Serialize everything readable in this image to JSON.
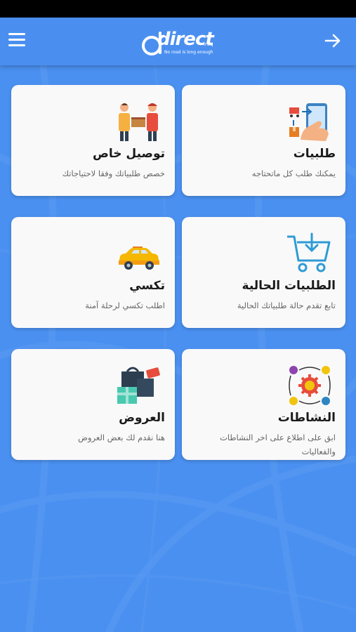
{
  "header": {
    "logo_text": "direct",
    "logo_sup": "iraq",
    "logo_tagline": "No road is long enough"
  },
  "cards": [
    {
      "title": "طلبيات",
      "subtitle": "يمكنك طلب كل ماتحتاجه",
      "icon": "phone-order-icon"
    },
    {
      "title": "توصيل خاص",
      "subtitle": "خصص طلبياتك وفقا لاحتياجاتك",
      "icon": "delivery-handover-icon"
    },
    {
      "title": "الطلبيات الحالية",
      "subtitle": "تابع تقدم حالة طلبياتك الحالية",
      "icon": "cart-icon"
    },
    {
      "title": "تكسي",
      "subtitle": "اطلب تكسي لرحلة آمنة",
      "icon": "taxi-icon"
    },
    {
      "title": "النشاطات",
      "subtitle": "ابق على اطلاع على اخر النشاطات والفعاليات",
      "icon": "activities-gear-icon"
    },
    {
      "title": "العروض",
      "subtitle": "هنا نقدم لك بعض العروض",
      "icon": "gift-bags-icon"
    }
  ],
  "colors": {
    "primary": "#4a8ff0",
    "card": "#f9f9f9",
    "title": "#1a1a1a",
    "subtitle": "#666666"
  }
}
